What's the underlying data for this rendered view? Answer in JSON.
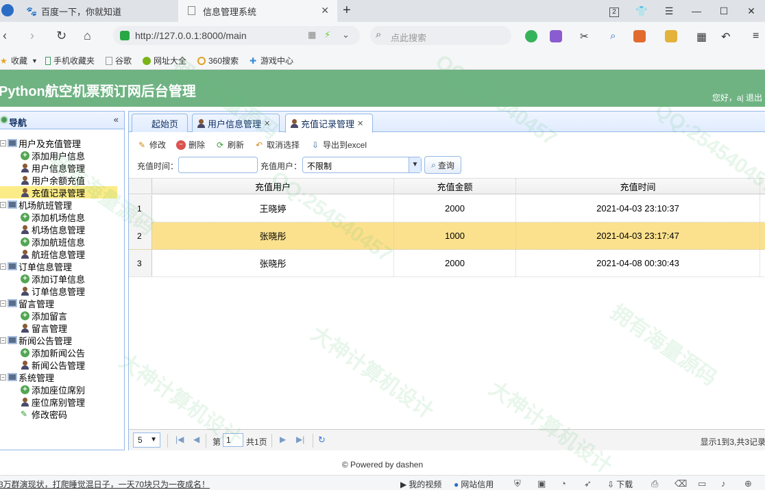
{
  "browser": {
    "tabs": [
      {
        "title": "百度一下，你就知道"
      },
      {
        "title": "信息管理系统"
      }
    ],
    "url": "http://127.0.0.1:8000/main",
    "search_placeholder": "点此搜索",
    "tab_count_badge": "2",
    "bookmarks": [
      "收藏",
      "手机收藏夹",
      "谷歌",
      "网址大全",
      "360搜索",
      "游戏中心"
    ]
  },
  "app": {
    "title": "Python航空机票预订网后台管理",
    "greeting": "您好，a| 退出"
  },
  "nav": {
    "title": "导航",
    "groups": [
      {
        "label": "用户及充值管理",
        "items": [
          "添加用户信息",
          "用户信息管理",
          "用户余额充值",
          "充值记录管理"
        ]
      },
      {
        "label": "机场航班管理",
        "items": [
          "添加机场信息",
          "机场信息管理",
          "添加航班信息",
          "航班信息管理"
        ]
      },
      {
        "label": "订单信息管理",
        "items": [
          "添加订单信息",
          "订单信息管理"
        ]
      },
      {
        "label": "留言管理",
        "items": [
          "添加留言",
          "留言管理"
        ]
      },
      {
        "label": "新闻公告管理",
        "items": [
          "添加新闻公告",
          "新闻公告管理"
        ]
      },
      {
        "label": "系统管理",
        "items": [
          "添加座位席别",
          "座位席别管理",
          "修改密码"
        ]
      }
    ],
    "selected": "充值记录管理"
  },
  "panel_tabs": [
    {
      "label": "起始页"
    },
    {
      "label": "用户信息管理"
    },
    {
      "label": "充值记录管理"
    }
  ],
  "toolbar": {
    "edit": "修改",
    "delete": "删除",
    "refresh": "刷新",
    "cancel_select": "取消选择",
    "export": "导出到excel"
  },
  "filter": {
    "time_label": "充值时间：",
    "time_value": "",
    "user_label": "充值用户：",
    "user_value": "不限制",
    "query": "查询"
  },
  "grid": {
    "columns": [
      "充值用户",
      "充值金额",
      "充值时间"
    ],
    "rows": [
      {
        "n": "1",
        "user": "王晓婷",
        "amount": "2000",
        "time": "2021-04-03 23:10:37"
      },
      {
        "n": "2",
        "user": "张晓彤",
        "amount": "1000",
        "time": "2021-04-03 23:17:47"
      },
      {
        "n": "3",
        "user": "张晓彤",
        "amount": "2000",
        "time": "2021-04-08 00:30:43"
      }
    ],
    "selected_row": 2
  },
  "pager": {
    "page_size": "5",
    "page_prefix": "第",
    "page": "1",
    "page_suffix": "共1页",
    "info": "显示1到3,共3记录"
  },
  "footer": "© Powered by dashen",
  "statusbar": {
    "news": "3万群演现状，打爬睡觉混日子，一天70块只为一夜成名！",
    "video": "我的视频",
    "credit": "网站信用",
    "download": "下载"
  },
  "watermark": [
    "QQ:254540457",
    "大神计算机设计",
    "拥有海量源码"
  ],
  "colors": {
    "header_green": "#6fb383",
    "selected_yellow": "#fbe18e",
    "border_blue": "#95b8e7"
  }
}
